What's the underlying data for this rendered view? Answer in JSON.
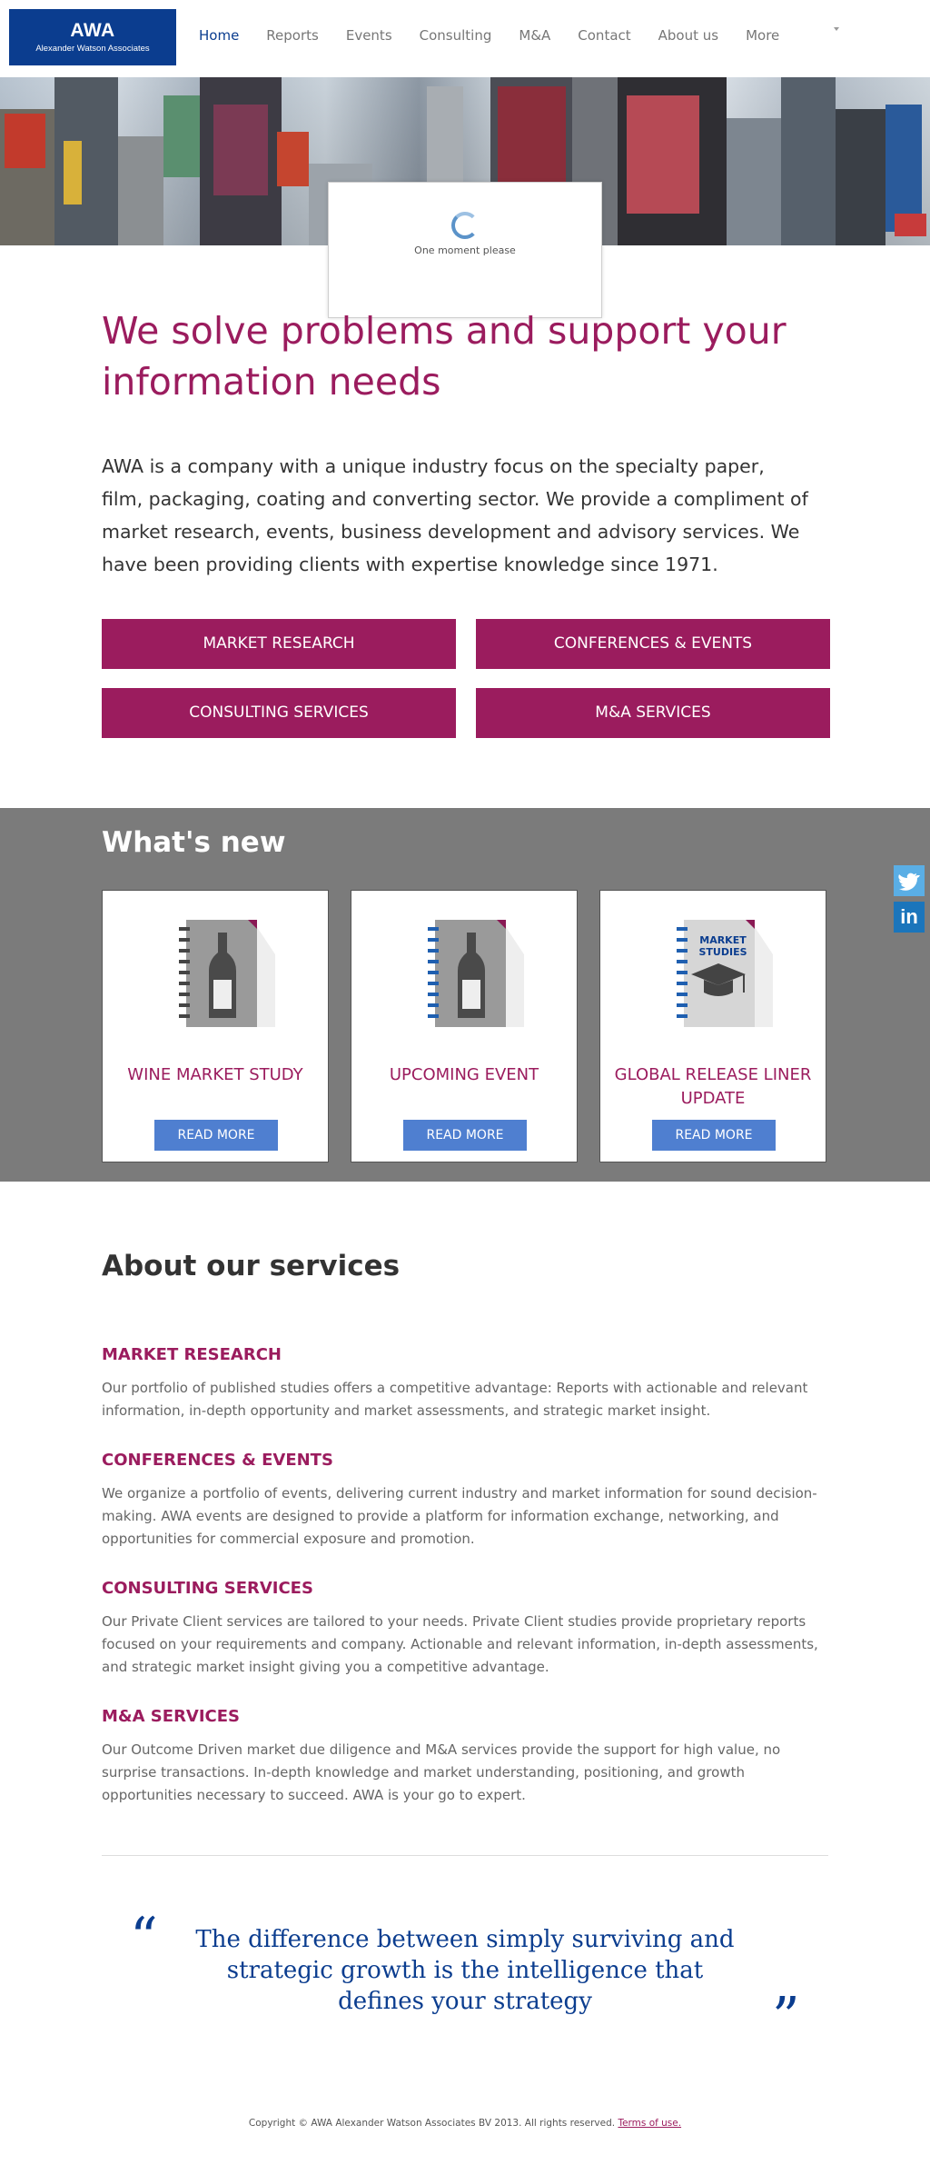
{
  "brand": {
    "logo_big": "AWA",
    "logo_small": "Alexander Watson Associates",
    "purple": "#9b1c5e",
    "navy": "#0b3d8f",
    "button_blue": "#4f7fd0"
  },
  "nav": {
    "items": [
      {
        "label": "Home",
        "active": true
      },
      {
        "label": "Reports"
      },
      {
        "label": "Events"
      },
      {
        "label": "Consulting"
      },
      {
        "label": "M&A"
      },
      {
        "label": "Contact"
      },
      {
        "label": "About us"
      },
      {
        "label": "More"
      }
    ]
  },
  "loader": {
    "text": "One moment please"
  },
  "intro": {
    "headline": "We solve problems and support your information needs",
    "body": "AWA is a company with a unique industry focus on the specialty paper, film, packaging, coating and converting sector. We provide a compliment of market research, events, business development and advisory services. We have been providing clients with expertise knowledge since 1971."
  },
  "service_buttons": [
    "MARKET RESEARCH",
    "CONFERENCES & EVENTS",
    "CONSULTING SERVICES",
    "M&A SERVICES"
  ],
  "whats_new": {
    "title": "What's new",
    "cards": [
      {
        "title": "WINE MARKET STUDY",
        "button": "READ MORE",
        "icon": "wine-bottle-notebook-icon"
      },
      {
        "title": "UPCOMING EVENT",
        "button": "READ MORE",
        "icon": "wine-bottle-notebook-icon"
      },
      {
        "title": "GLOBAL RELEASE LINER UPDATE",
        "button": "READ MORE",
        "icon": "market-studies-notebook-icon",
        "icon_text": "MARKET STUDIES"
      }
    ]
  },
  "about": {
    "title": "About our services",
    "services": [
      {
        "head": "MARKET RESEARCH",
        "desc": "Our portfolio of published studies offers a competitive advantage: Reports with actionable and relevant information, in-depth opportunity and market assessments, and strategic market insight."
      },
      {
        "head": "CONFERENCES & EVENTS",
        "desc": "We organize a portfolio of events, delivering current industry and market information for sound decision-making. AWA events are designed to provide a platform for information exchange, networking, and opportunities for commercial exposure and promotion."
      },
      {
        "head": "CONSULTING SERVICES",
        "desc": "Our Private Client services are tailored to your needs. Private Client studies provide proprietary reports focused on your requirements and company. Actionable and relevant information, in-depth assessments, and strategic market insight giving you a competitive advantage."
      },
      {
        "head": "M&A SERVICES",
        "desc": "Our Outcome Driven market due diligence and M&A services provide the support for high value, no surprise transactions. In-depth knowledge and market understanding, positioning, and growth opportunities necessary to succeed. AWA is your go to expert."
      }
    ]
  },
  "quote": {
    "open": "“",
    "text": "The difference between simply surviving and strategic growth is the intelligence that defines your strategy",
    "close": "”"
  },
  "footer": {
    "copyright": "Copyright © AWA Alexander Watson Associates BV 2013. All rights reserved.",
    "terms": "Terms of use."
  },
  "social": {
    "twitter_icon": "twitter-icon",
    "linkedin_label": "in"
  }
}
